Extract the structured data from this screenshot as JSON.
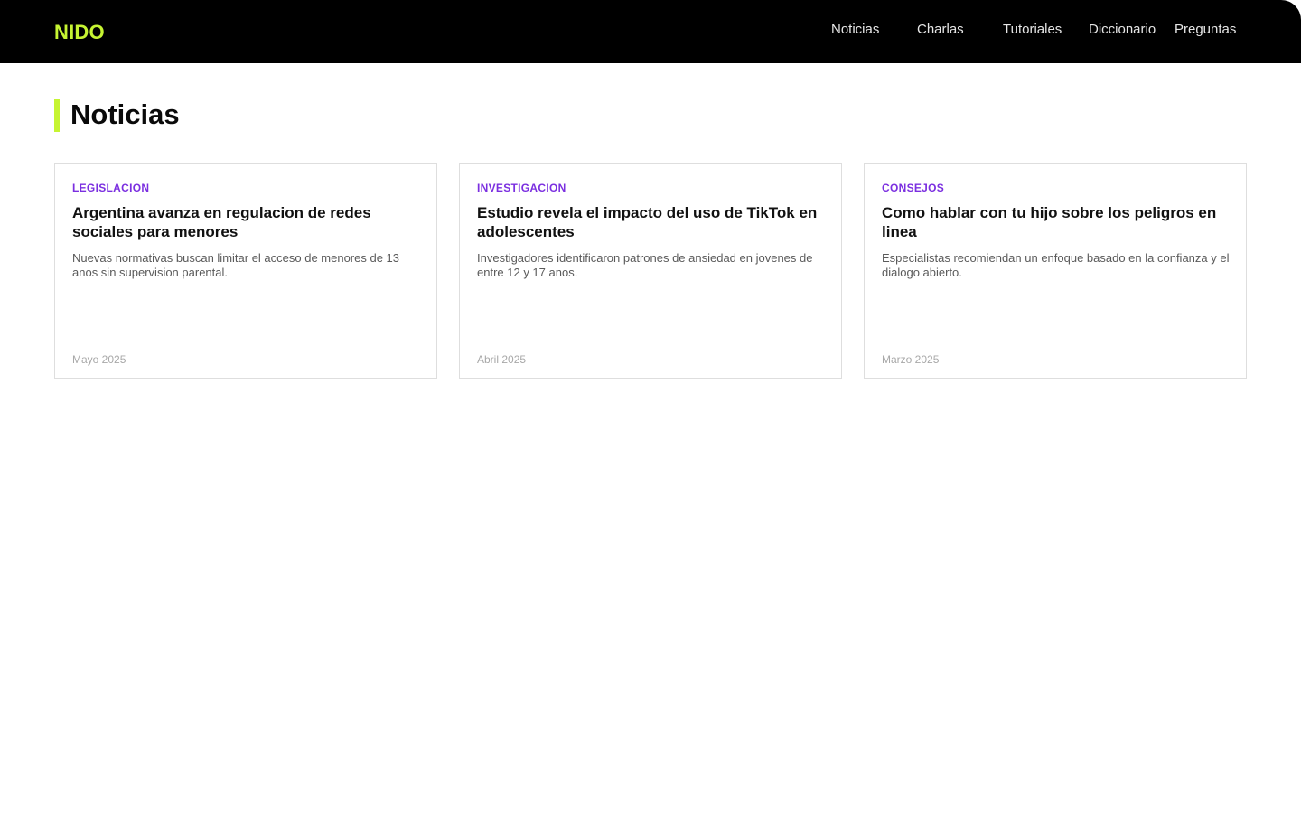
{
  "header": {
    "logo": "NIDO",
    "nav": [
      {
        "label": "Noticias"
      },
      {
        "label": "Charlas"
      },
      {
        "label": "Tutoriales"
      },
      {
        "label": "Diccionario"
      },
      {
        "label": "Preguntas"
      }
    ]
  },
  "main": {
    "section_title": "Noticias",
    "cards": [
      {
        "category": "LEGISLACION",
        "title": "Argentina avanza en regulacion de redes sociales para menores",
        "description": "Nuevas normativas buscan limitar el acceso de menores de 13 anos sin supervision parental.",
        "date": "Mayo 2025"
      },
      {
        "category": "INVESTIGACION",
        "title": "Estudio revela el impacto del uso de TikTok en adolescentes",
        "description": "Investigadores identificaron patrones de ansiedad en jovenes de entre 12 y 17 anos.",
        "date": "Abril 2025"
      },
      {
        "category": "CONSEJOS",
        "title": "Como hablar con tu hijo sobre los peligros en linea",
        "description": "Especialistas recomiendan un enfoque basado en la confianza y el dialogo abierto.",
        "date": "Marzo 2025"
      }
    ]
  },
  "colors": {
    "header_bg": "#000000",
    "brand_accent": "#c6f432",
    "category": "#7b2fe0",
    "card_border": "#dedede"
  }
}
